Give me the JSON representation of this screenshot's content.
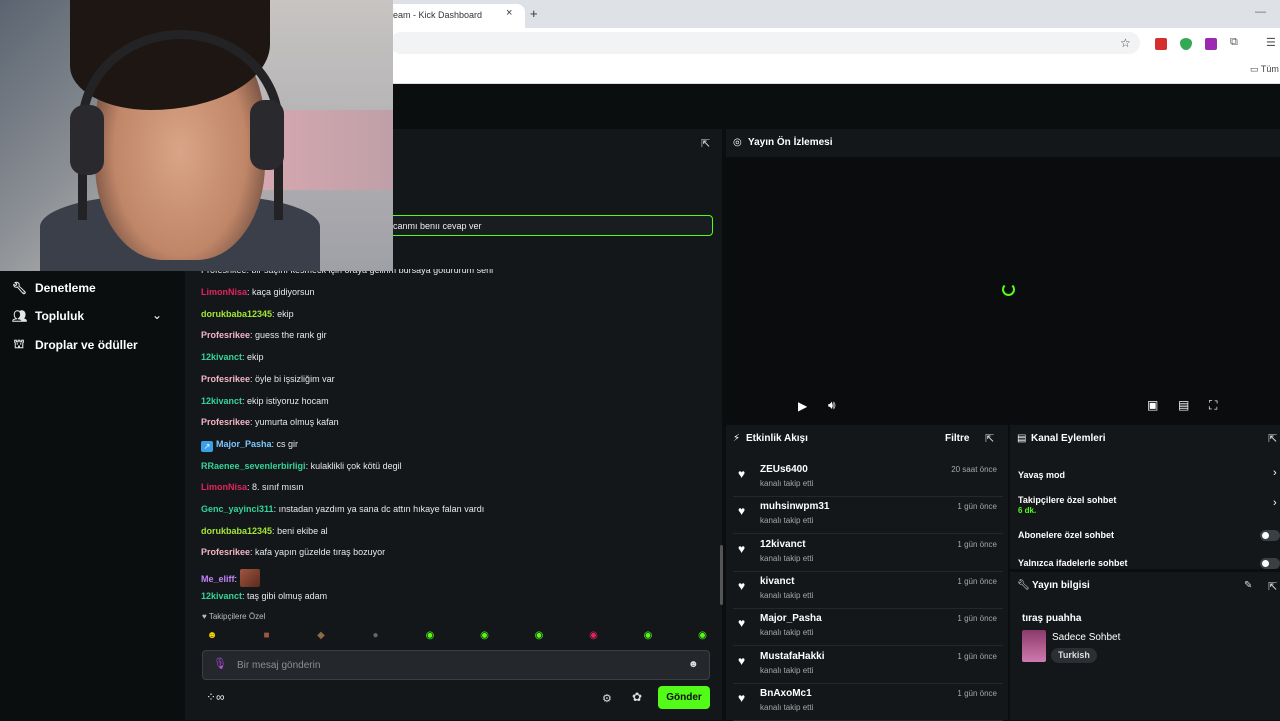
{
  "browser": {
    "tab_title": "eam - Kick Dashboard",
    "tab_close": "×",
    "new_tab": "+",
    "minimize": "—",
    "bookmarks_all": "Tüm"
  },
  "sidebar": {
    "items": [
      {
        "label": "Denetleme",
        "icon": "wrench-icon"
      },
      {
        "label": "Topluluk",
        "icon": "community-icon"
      },
      {
        "label": "Droplar ve ödüller",
        "icon": "cake-icon"
      }
    ]
  },
  "chat": {
    "pinned_text": "canmı benıı cevap ver",
    "partial_line": "Profesrikee: bir saçını kesmeck için oraya gelirim bursaya götürürüm seni",
    "messages": [
      {
        "user": "LimonNisa",
        "color": "#e0245e",
        "text": "kaça gidiyorsun"
      },
      {
        "user": "dorukbaba12345",
        "color": "#a3e635",
        "text": "ekip"
      },
      {
        "user": "Profesrikee",
        "color": "#f2b6c6",
        "text": "guess the rank gir"
      },
      {
        "user": "12kivanct",
        "color": "#34d399",
        "text": "ekip"
      },
      {
        "user": "Profesrikee",
        "color": "#f2b6c6",
        "text": "öyle bi işsizliğim var"
      },
      {
        "user": "12kivanct",
        "color": "#34d399",
        "text": "ekip istiyoruz hocam"
      },
      {
        "user": "Profesrikee",
        "color": "#f2b6c6",
        "text": "yumurta olmuş kafan"
      },
      {
        "user": "Major_Pasha",
        "color": "#7cc7ff",
        "text": "cs gir",
        "badge": "↗"
      },
      {
        "user": "RRaenee_sevenlerbirligi",
        "color": "#34d399",
        "text": "kulaklikli çok kötü degil"
      },
      {
        "user": "LimonNisa",
        "color": "#e0245e",
        "text": "8. sınıf mısın"
      },
      {
        "user": "Genc_yayinci311",
        "color": "#34d399",
        "text": "ınstadan yazdım ya sana dc attın hıkaye falan vardı"
      },
      {
        "user": "dorukbaba12345",
        "color": "#a3e635",
        "text": "beni ekibe al"
      },
      {
        "user": "Profesrikee",
        "color": "#f2b6c6",
        "text": "kafa yapın güzelde tıraş bozuyor"
      },
      {
        "user": "Me_eliff",
        "color": "#c084fc",
        "text": "",
        "emote": true
      },
      {
        "user": "12kivanct",
        "color": "#34d399",
        "text": "taş gibi olmuş adam"
      }
    ],
    "followers_only": "♥ Takipçilere Özel",
    "emotes": [
      {
        "glyph": "☻",
        "color": "#f5d000"
      },
      {
        "glyph": "■",
        "color": "#a0553e"
      },
      {
        "glyph": "◆",
        "color": "#8b6b4a"
      },
      {
        "glyph": "●",
        "color": "#666666"
      },
      {
        "glyph": "◉",
        "color": "#53fc18"
      },
      {
        "glyph": "◉",
        "color": "#53fc18"
      },
      {
        "glyph": "◉",
        "color": "#53fc18"
      },
      {
        "glyph": "◉",
        "color": "#e0245e"
      },
      {
        "glyph": "◉",
        "color": "#53fc18"
      },
      {
        "glyph": "◉",
        "color": "#53fc18"
      }
    ],
    "input_placeholder": "Bir mesaj gönderin",
    "send_label": "Gönder"
  },
  "preview": {
    "title": "Yayın Ön İzlemesi"
  },
  "activity": {
    "title": "Etkinlik Akışı",
    "filter_label": "Filtre",
    "items": [
      {
        "user": "ZEUs6400",
        "action": "kanalı takip etti",
        "time": "20 saat önce"
      },
      {
        "user": "muhsinwpm31",
        "action": "kanalı takip etti",
        "time": "1 gün önce"
      },
      {
        "user": "12kivanct",
        "action": "kanalı takip etti",
        "time": "1 gün önce"
      },
      {
        "user": "kivanct",
        "action": "kanalı takip etti",
        "time": "1 gün önce"
      },
      {
        "user": "Major_Pasha",
        "action": "kanalı takip etti",
        "time": "1 gün önce"
      },
      {
        "user": "MustafaHakki",
        "action": "kanalı takip etti",
        "time": "1 gün önce"
      },
      {
        "user": "BnAxoMc1",
        "action": "kanalı takip etti",
        "time": "1 gün önce"
      }
    ]
  },
  "actions": {
    "title": "Kanal Eylemleri",
    "slow_mode": "Yavaş mod",
    "followers_chat": "Takipçilere özel sohbet",
    "followers_duration": "6 dk.",
    "subs_chat": "Abonelere özel sohbet",
    "emote_chat": "Yalnızca ifadelerle sohbet"
  },
  "stream_info": {
    "title_label": "Yayın bilgisi",
    "stream_title": "tıraş puahha",
    "category": "Sadece Sohbet",
    "language_tag": "Turkish"
  },
  "colors": {
    "accent": "#53fc18",
    "panel": "#141719",
    "background": "#0b0e0f"
  }
}
